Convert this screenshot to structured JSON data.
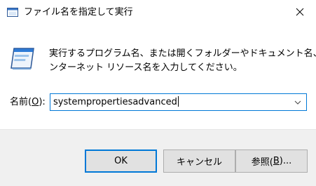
{
  "window": {
    "title": "ファイル名を指定して実行"
  },
  "description": {
    "line1": "実行するプログラム名、または開くフォルダーやドキュメント名、イ",
    "line2": "ンターネット リソース名を入力してください。"
  },
  "open_field": {
    "label_prefix": "名前(",
    "label_accel": "O",
    "label_suffix": "):",
    "value": "systempropertiesadvanced"
  },
  "buttons": {
    "ok_label": "OK",
    "cancel_label": "キャンセル",
    "browse_prefix": "参照(",
    "browse_accel": "B",
    "browse_suffix": ")..."
  },
  "colors": {
    "accent": "#0078d7",
    "footer_bg": "#f0f0f0",
    "button_bg": "#e1e1e1"
  },
  "icons": {
    "title": "run-dialog-icon",
    "close": "close-icon",
    "main": "run-program-icon",
    "dropdown": "chevron-down-icon"
  }
}
